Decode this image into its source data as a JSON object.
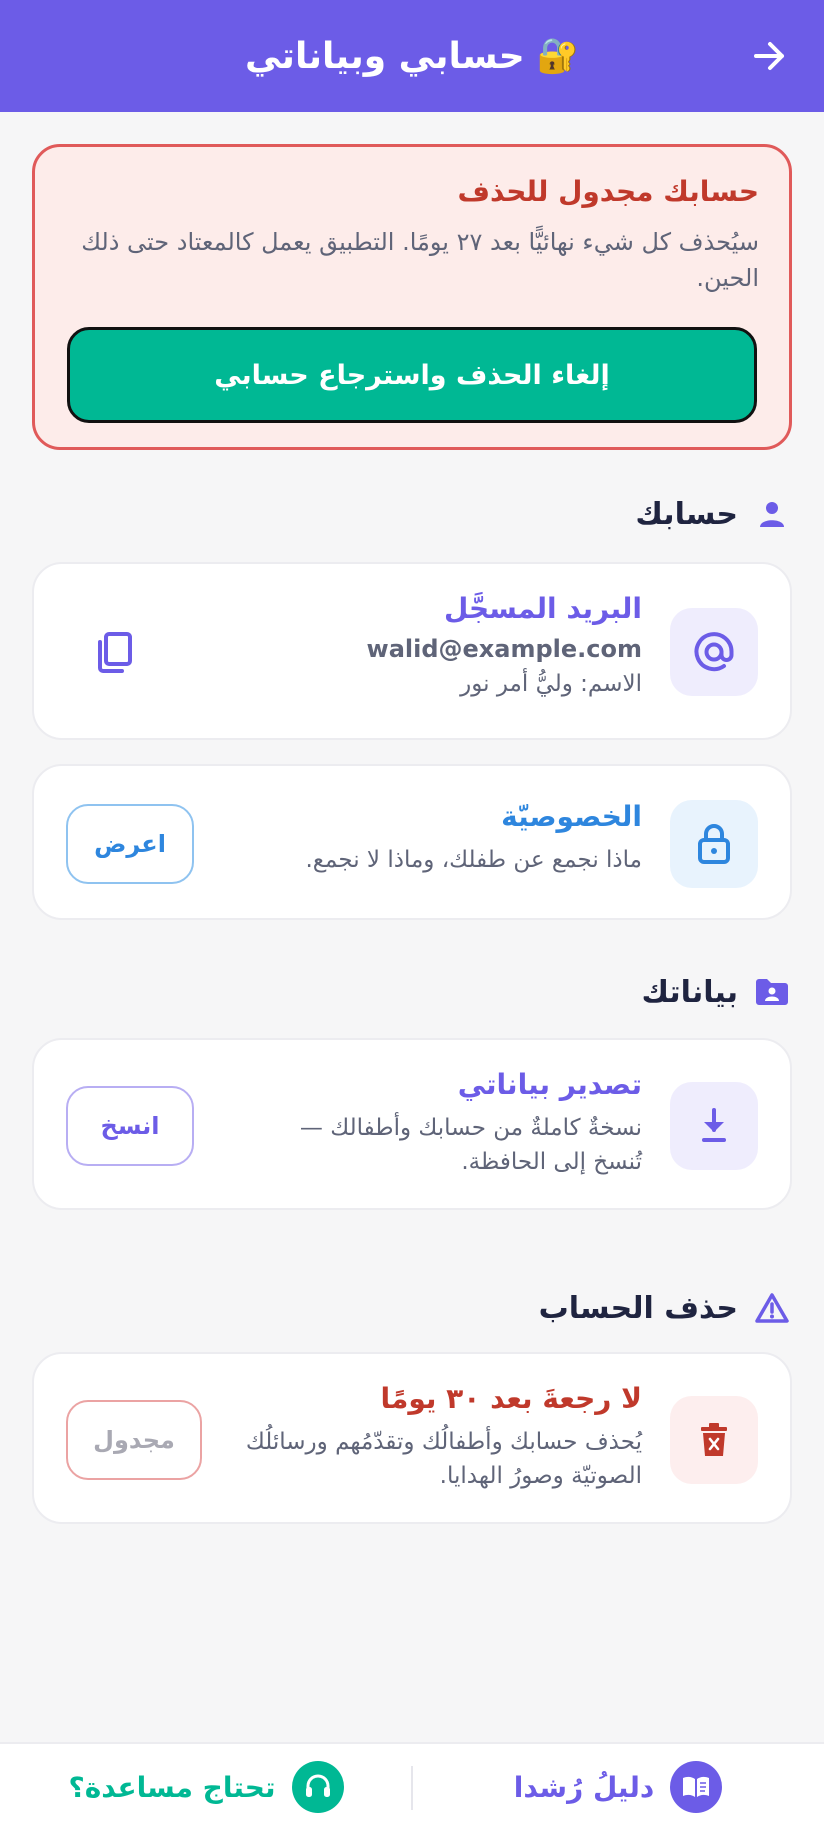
{
  "header": {
    "title": "حسابي وبياناتي",
    "lock_emoji": "🔐",
    "back_icon": "arrow-right-icon",
    "background": "#6c5ce7"
  },
  "alert": {
    "title": "حسابك مجدول للحذف",
    "body": "سيُحذف كل شيء نهائيًّا بعد ٢٧ يومًا. التطبيق يعمل كالمعتاد حتى ذلك الحين.",
    "restore_button": "إلغاء الحذف واسترجاع حسابي",
    "accent": "#e05a5a",
    "button_color": "#00b894"
  },
  "sections": {
    "account": {
      "title": "حسابك",
      "icon": "person-icon"
    },
    "data": {
      "title": "بياناتك",
      "icon": "folder-user-icon"
    },
    "delete": {
      "title": "حذف الحساب",
      "icon": "warning-triangle-icon"
    }
  },
  "email_card": {
    "title": "البريد المسجَّل",
    "email": "walid@example.com",
    "name_line": "الاسم: وليُّ أمر نور",
    "icon": "at-icon",
    "action_icon": "copy-icon"
  },
  "privacy_card": {
    "title": "الخصوصيّة",
    "subtitle": "ماذا نجمع عن طفلك، وماذا لا نجمع.",
    "button": "اعرض",
    "icon": "lock-icon",
    "color": "#2e86de"
  },
  "export_card": {
    "title": "تصدير بياناتي",
    "subtitle": "نسخةٌ كاملةٌ من حسابك وأطفالك — تُنسخ إلى الحافظة.",
    "button": "انسخ",
    "icon": "download-icon",
    "color": "#6c5ce7"
  },
  "delete_card": {
    "title": "لا رجعةَ بعد ٣٠ يومًا",
    "subtitle": "يُحذف حسابك وأطفالُك وتقدّمُهم ورسائلُك الصوتيّة وصورُ الهدايا.",
    "button": "مجدول",
    "icon": "trash-x-icon",
    "color": "#c0392b"
  },
  "bottom_bar": {
    "guide_label": "دليلُ رُشدا",
    "guide_icon": "book-icon",
    "help_label": "تحتاج مساعدة؟",
    "help_icon": "headset-icon"
  }
}
